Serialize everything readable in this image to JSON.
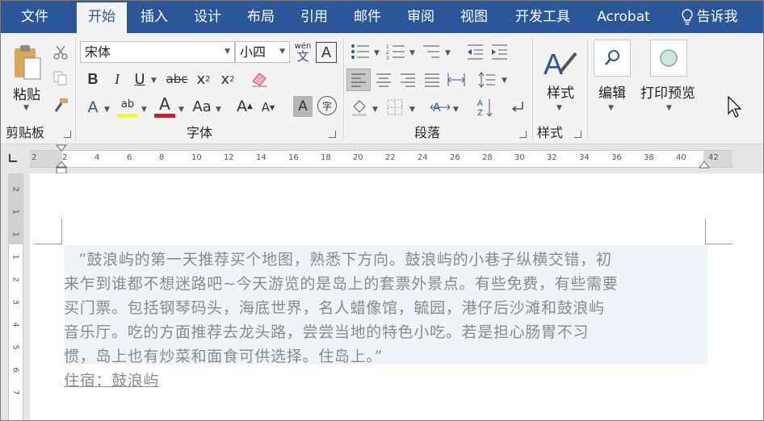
{
  "tabs": [
    {
      "label": "文件",
      "active": false
    },
    {
      "label": "开始",
      "active": true
    },
    {
      "label": "插入",
      "active": false
    },
    {
      "label": "设计",
      "active": false
    },
    {
      "label": "布局",
      "active": false
    },
    {
      "label": "引用",
      "active": false
    },
    {
      "label": "邮件",
      "active": false
    },
    {
      "label": "审阅",
      "active": false
    },
    {
      "label": "视图",
      "active": false
    },
    {
      "label": "开发工具",
      "active": false
    },
    {
      "label": "Acrobat",
      "active": false
    }
  ],
  "tell_me": "告诉我",
  "clipboard": {
    "paste_label": "粘贴",
    "group_label": "剪贴板"
  },
  "font": {
    "group_label": "字体",
    "font_name": "宋体",
    "font_size": "小四",
    "phonetic_top": "wén",
    "phonetic_bottom": "文",
    "bold": "B",
    "italic": "I",
    "underline": "U",
    "strike": "abc",
    "subscript": "x",
    "superscript": "x",
    "change_case": "Aa",
    "grow": "A",
    "shrink": "A",
    "char_shade": "A",
    "enclose": "字",
    "highlight_color": "#ffff00",
    "font_color": "#e81123"
  },
  "paragraph": {
    "group_label": "段落"
  },
  "styles": {
    "button_label": "样式",
    "group_label": "样式"
  },
  "editing": {
    "button_label": "编辑"
  },
  "print_preview": {
    "button_label": "打印预览"
  },
  "ruler": {
    "h_ticks": [
      "2",
      "2",
      "4",
      "6",
      "8",
      "10",
      "12",
      "14",
      "16",
      "18",
      "20",
      "22",
      "24",
      "26",
      "28",
      "30",
      "32",
      "34",
      "36",
      "38",
      "40",
      "42"
    ],
    "v_ticks": [
      "2",
      "1",
      "1",
      "1",
      "2",
      "3",
      "4",
      "5",
      "6",
      "7"
    ]
  },
  "document": {
    "lines": [
      "“鼓浪屿的第一天推荐买个地图，熟悉下方向。鼓浪屿的小巷子纵横交错，初",
      "来乍到谁都不想迷路吧~今天游览的是岛上的套票外景点。有些免费，有些需要",
      "买门票。包括钢琴码头，海底世界，名人蜡像馆，毓园，港仔后沙滩和鼓浪屿",
      "音乐厅。吃的方面推荐去龙头路，尝尝当地的特色小吃。若是担心肠胃不习",
      "惯，岛上也有炒菜和面食可供选择。住岛上。”"
    ],
    "heading": "住宿：鼓浪屿"
  }
}
